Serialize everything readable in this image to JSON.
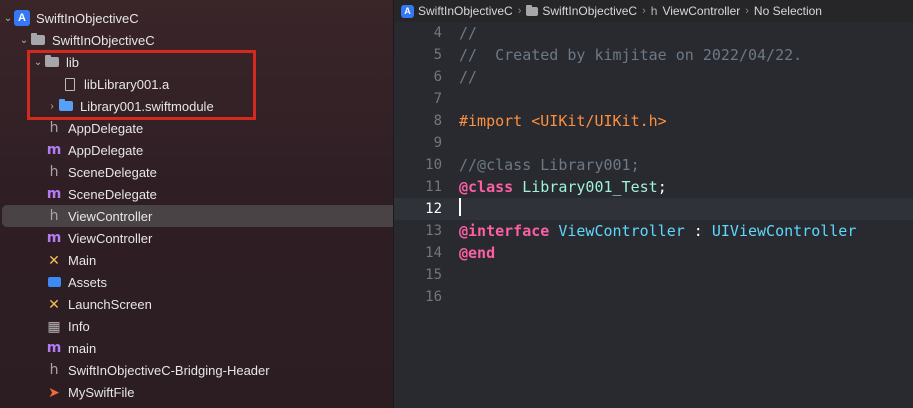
{
  "navigator": {
    "project": "SwiftInObjectiveC",
    "group": "SwiftInObjectiveC",
    "lib_folder": "lib",
    "lib_file": "libLibrary001.a",
    "lib_module": "Library001.swiftmodule",
    "files": [
      {
        "name": "AppDelegate",
        "kind": "h"
      },
      {
        "name": "AppDelegate",
        "kind": "m"
      },
      {
        "name": "SceneDelegate",
        "kind": "h"
      },
      {
        "name": "SceneDelegate",
        "kind": "m"
      },
      {
        "name": "ViewController",
        "kind": "h",
        "selected": true
      },
      {
        "name": "ViewController",
        "kind": "m"
      },
      {
        "name": "Main",
        "kind": "storyboard"
      },
      {
        "name": "Assets",
        "kind": "assets"
      },
      {
        "name": "LaunchScreen",
        "kind": "storyboard"
      },
      {
        "name": "Info",
        "kind": "plist"
      },
      {
        "name": "main",
        "kind": "m"
      },
      {
        "name": "SwiftInObjectiveC-Bridging-Header",
        "kind": "h"
      },
      {
        "name": "MySwiftFile",
        "kind": "swift"
      }
    ]
  },
  "jumpbar": {
    "project": "SwiftInObjectiveC",
    "group": "SwiftInObjectiveC",
    "file_glyph": "h",
    "file": "ViewController",
    "selection": "No Selection"
  },
  "editor": {
    "current_line": "12",
    "lines": [
      {
        "num": "4",
        "tokens": [
          {
            "t": "//",
            "c": "comment"
          }
        ]
      },
      {
        "num": "5",
        "tokens": [
          {
            "t": "//  Created by kimjitae on 2022/04/22.",
            "c": "comment"
          }
        ]
      },
      {
        "num": "6",
        "tokens": [
          {
            "t": "//",
            "c": "comment"
          }
        ]
      },
      {
        "num": "7",
        "tokens": []
      },
      {
        "num": "8",
        "tokens": [
          {
            "t": "#import <UIKit/UIKit.h>",
            "c": "preproc"
          }
        ]
      },
      {
        "num": "9",
        "tokens": []
      },
      {
        "num": "10",
        "tokens": [
          {
            "t": "//@class Library001;",
            "c": "comment"
          }
        ]
      },
      {
        "num": "11",
        "tokens": [
          {
            "t": "@class",
            "c": "kw"
          },
          {
            "t": " ",
            "c": "plain"
          },
          {
            "t": "Library001_Test",
            "c": "type"
          },
          {
            "t": ";",
            "c": "plain"
          }
        ]
      },
      {
        "num": "12",
        "tokens": []
      },
      {
        "num": "13",
        "tokens": [
          {
            "t": "@interface",
            "c": "kw"
          },
          {
            "t": " ",
            "c": "plain"
          },
          {
            "t": "ViewController",
            "c": "class"
          },
          {
            "t": " : ",
            "c": "plain"
          },
          {
            "t": "UIViewController",
            "c": "class"
          }
        ]
      },
      {
        "num": "14",
        "tokens": [
          {
            "t": "@end",
            "c": "kw"
          }
        ]
      },
      {
        "num": "15",
        "tokens": []
      },
      {
        "num": "16",
        "tokens": []
      }
    ]
  },
  "colors": {
    "highlight_box": "#d42a1d",
    "keyword": "#fc5fa3",
    "preprocessor": "#fd8f3f",
    "comment": "#6c7986",
    "class_name": "#5dd8ff",
    "type_name": "#9ef1dd"
  }
}
